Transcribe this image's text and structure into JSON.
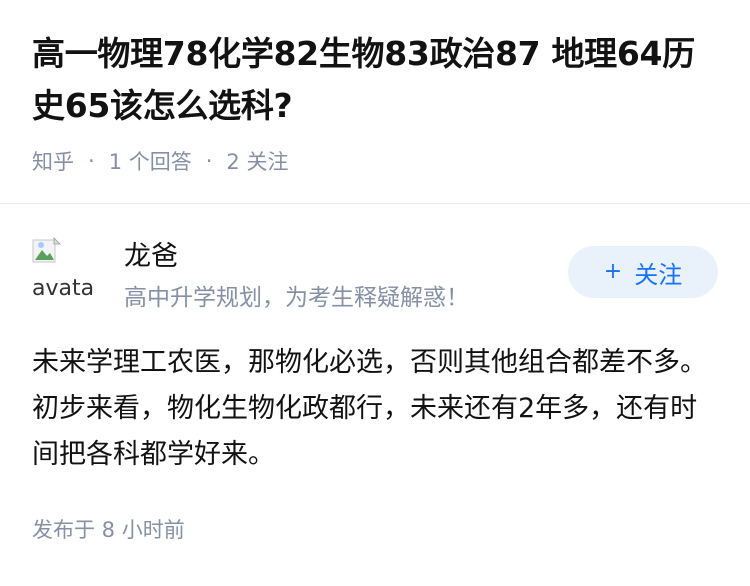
{
  "question": {
    "title": "高一物理78化学82生物83政治87 地理64历史65该怎么选科?",
    "source": "知乎",
    "answer_count": "1 个回答",
    "follower_count": "2 关注",
    "separator": "·"
  },
  "answer": {
    "author": {
      "name": "龙爸",
      "headline": "高中升学规划，为考生释疑解惑！",
      "avatar_alt": "avatar"
    },
    "follow_button": {
      "label": "关注",
      "icon": "plus-icon"
    },
    "content": "未来学理工农医，那物化必选，否则其他组合都差不多。初步来看，物化生物化政都行，未来还有2年多，还有时间把各科都学好来。",
    "published": "发布于  8 小时前"
  },
  "colors": {
    "meta_gray": "#8590a6",
    "accent_blue": "#1772f6",
    "button_bg": "#e9f1fb"
  }
}
